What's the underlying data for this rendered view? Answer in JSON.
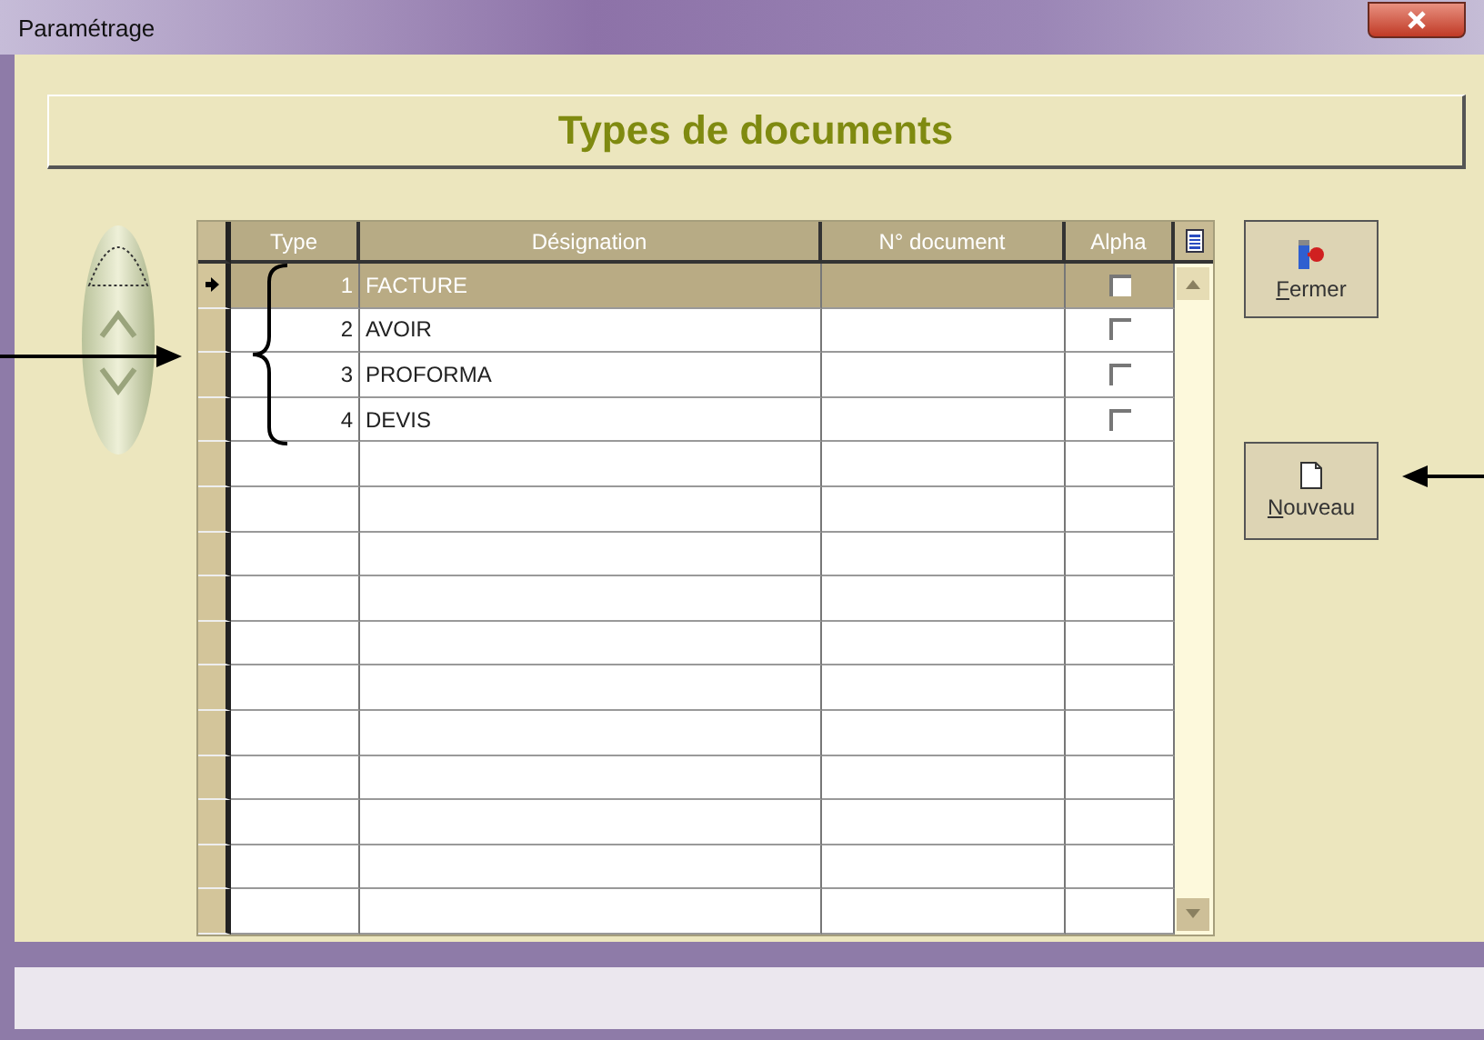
{
  "window": {
    "title": "Paramétrage"
  },
  "header": {
    "title": "Types de documents"
  },
  "table": {
    "columns": [
      "Type",
      "Désignation",
      "N° document",
      "Alpha"
    ],
    "rows": [
      {
        "type": "1",
        "designation": "FACTURE",
        "alpha_checked": false,
        "selected": true
      },
      {
        "type": "2",
        "designation": "AVOIR",
        "alpha_checked": false,
        "selected": false
      },
      {
        "type": "3",
        "designation": "PROFORMA",
        "alpha_checked": false,
        "selected": false
      },
      {
        "type": "4",
        "designation": "DEVIS",
        "alpha_checked": false,
        "selected": false
      }
    ]
  },
  "buttons": [
    {
      "kind": "close",
      "label": "Fermer"
    },
    {
      "kind": "new",
      "label": "Nouveau"
    }
  ]
}
